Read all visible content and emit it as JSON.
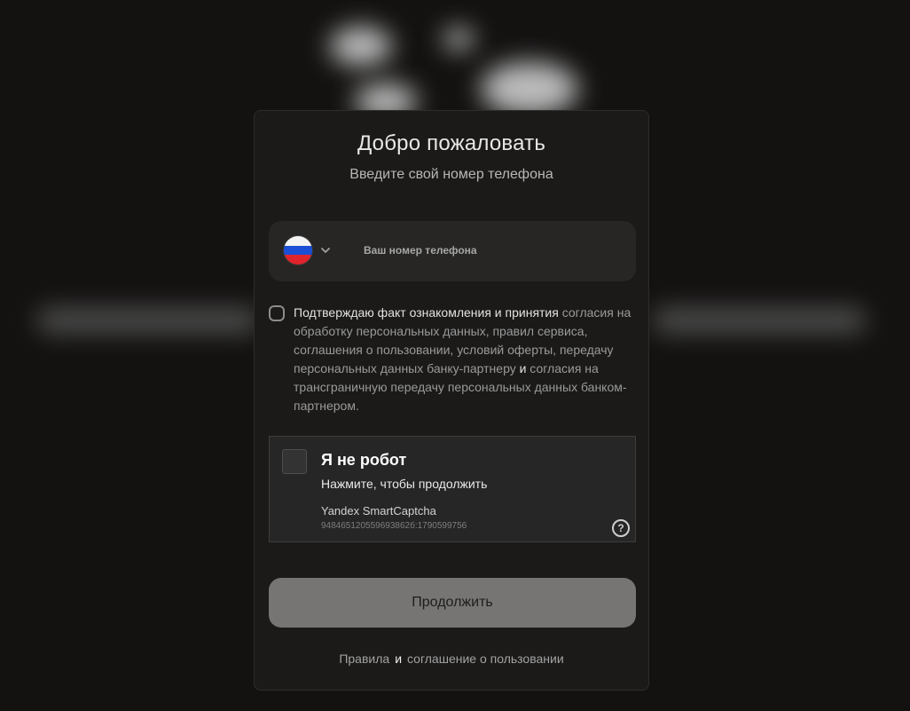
{
  "modal": {
    "title": "Добро пожаловать",
    "subtitle": "Введите свой номер телефона"
  },
  "phone": {
    "placeholder": "Ваш номер телефона",
    "country_flag_icon": "russia-flag-icon",
    "value": ""
  },
  "consent": {
    "checked": false,
    "part1": "Подтверждаю факт ознакомления и принятия",
    "part2": " согласия на обработку персональных данных, правил сервиса, соглашения о пользовании, условий оферты, передачу персональных данных банку-партнеру ",
    "part3": "и",
    "part4": " согласия на трансграничную передачу персональных данных банком-партнером."
  },
  "captcha": {
    "title": "Я не робот",
    "subtitle": "Нажмите, чтобы продолжить",
    "brand": "Yandex SmartCaptcha",
    "id": "948465120559693862б:1790599756",
    "help_icon": "help-icon"
  },
  "continue_label": "Продолжить",
  "footer": {
    "rules": "Правила",
    "and": "и",
    "agreement": "соглашение о пользовании"
  },
  "colors": {
    "background": "#131211",
    "panel": "#1b1a19",
    "button": "#767574"
  }
}
